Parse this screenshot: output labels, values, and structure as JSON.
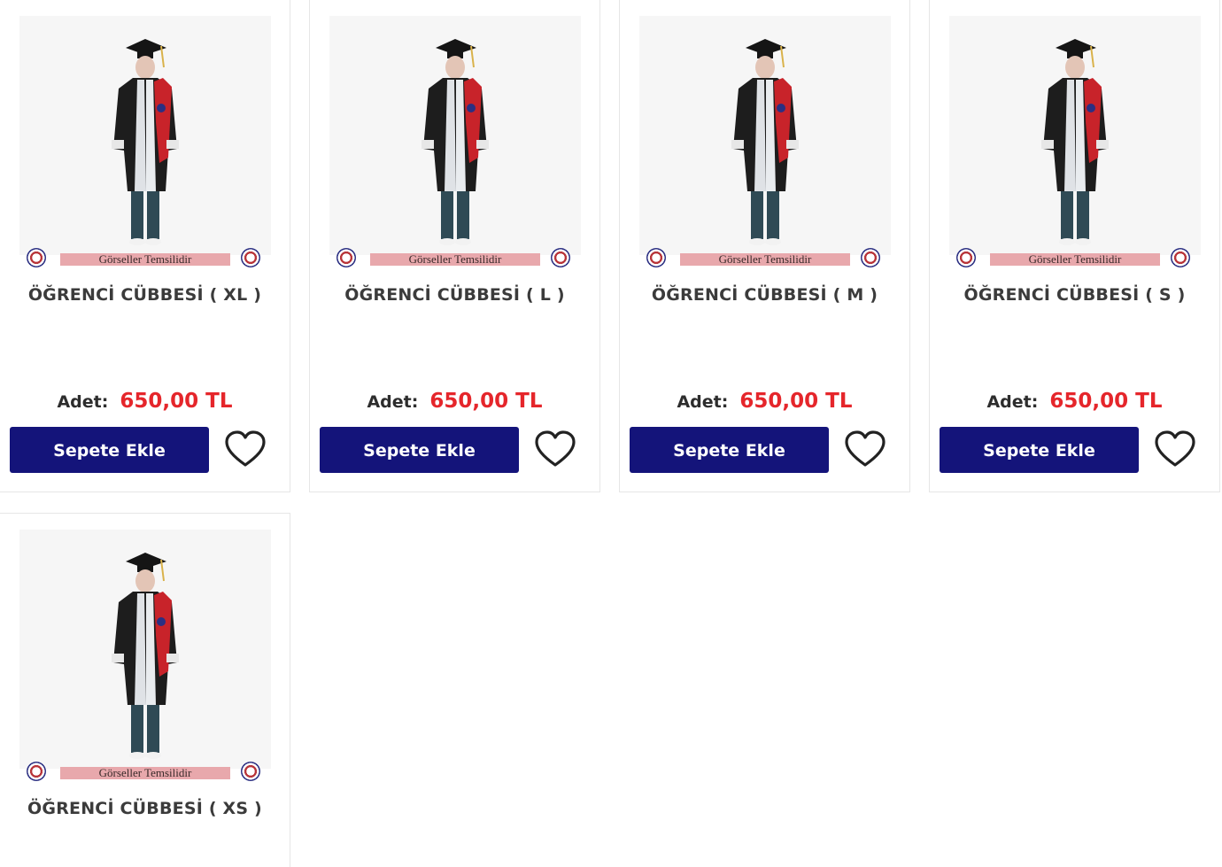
{
  "products": [
    {
      "title": "ÖĞRENCİ CÜBBESİ ( XL )",
      "qty_label": "Adet:",
      "price": "650,00 TL",
      "button": "Sepete Ekle",
      "image_caption": "Görseller Temsilidir"
    },
    {
      "title": "ÖĞRENCİ CÜBBESİ ( L )",
      "qty_label": "Adet:",
      "price": "650,00 TL",
      "button": "Sepete Ekle",
      "image_caption": "Görseller Temsilidir"
    },
    {
      "title": "ÖĞRENCİ CÜBBESİ ( M )",
      "qty_label": "Adet:",
      "price": "650,00 TL",
      "button": "Sepete Ekle",
      "image_caption": "Görseller Temsilidir"
    },
    {
      "title": "ÖĞRENCİ CÜBBESİ ( S )",
      "qty_label": "Adet:",
      "price": "650,00 TL",
      "button": "Sepete Ekle",
      "image_caption": "Görseller Temsilidir"
    },
    {
      "title": "ÖĞRENCİ CÜBBESİ ( XS )",
      "image_caption": "Görseller Temsilidir"
    }
  ],
  "colors": {
    "button": "#14147a",
    "price": "#e5262b",
    "border": "#e6e6e6"
  },
  "icons": {
    "favorite": "heart-outline-icon"
  }
}
